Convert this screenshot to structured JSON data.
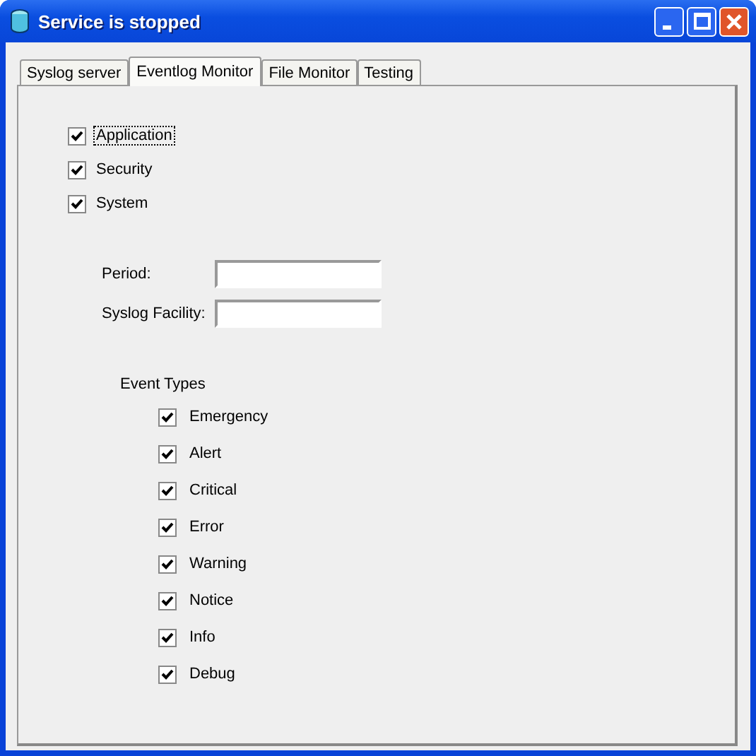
{
  "window": {
    "title": "Service is stopped"
  },
  "tabs": [
    {
      "label": "Syslog server",
      "selected": false
    },
    {
      "label": "Eventlog Monitor",
      "selected": true
    },
    {
      "label": "File Monitor",
      "selected": false
    },
    {
      "label": "Testing",
      "selected": false
    }
  ],
  "logs": [
    {
      "label": "Application",
      "checked": true,
      "focused": true
    },
    {
      "label": "Security",
      "checked": true,
      "focused": false
    },
    {
      "label": "System",
      "checked": true,
      "focused": false
    }
  ],
  "fields": [
    {
      "label": "Period:"
    },
    {
      "label": "Syslog Facility:"
    }
  ],
  "event_types": {
    "title": "Event Types",
    "items": [
      {
        "label": "Emergency",
        "checked": true
      },
      {
        "label": "Alert",
        "checked": true
      },
      {
        "label": "Critical",
        "checked": true
      },
      {
        "label": "Error",
        "checked": true
      },
      {
        "label": "Warning",
        "checked": true
      },
      {
        "label": "Notice",
        "checked": true
      },
      {
        "label": "Info",
        "checked": true
      },
      {
        "label": "Debug",
        "checked": true
      }
    ]
  }
}
